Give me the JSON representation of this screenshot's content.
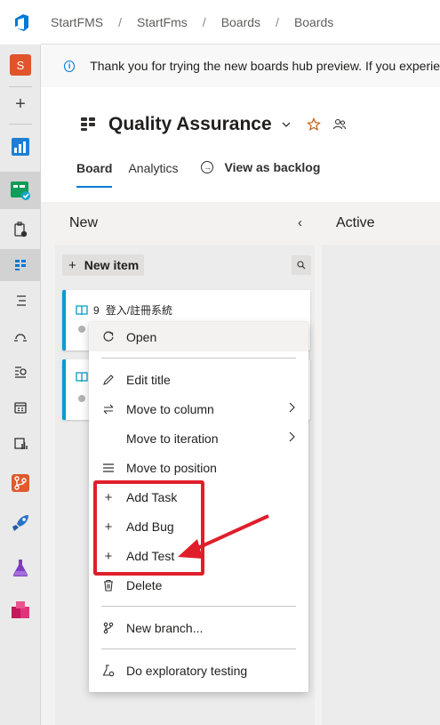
{
  "breadcrumb": {
    "items": [
      "StartFMS",
      "StartFms",
      "Boards",
      "Boards"
    ]
  },
  "rail": {
    "avatar_letter": "S"
  },
  "banner": {
    "text": "Thank you for trying the new boards hub preview. If you experie"
  },
  "header": {
    "title": "Quality Assurance"
  },
  "tabs": {
    "board": "Board",
    "analytics": "Analytics",
    "backlog": "View as backlog"
  },
  "columns": {
    "new": "New",
    "active": "Active"
  },
  "board": {
    "new_item_label": "New item"
  },
  "cards": [
    {
      "id": "9",
      "title": "登入/註冊系統"
    }
  ],
  "menu": {
    "open": "Open",
    "edit_title": "Edit title",
    "move_to_column": "Move to column",
    "move_to_iteration": "Move to iteration",
    "move_to_position": "Move to position",
    "add_task": "Add Task",
    "add_bug": "Add Bug",
    "add_test": "Add Test",
    "delete": "Delete",
    "new_branch": "New branch...",
    "exploratory_testing": "Do exploratory testing"
  },
  "colors": {
    "accent": "#0078d4",
    "card_border": "#009ccc",
    "annotation_red": "#e01e2b"
  }
}
